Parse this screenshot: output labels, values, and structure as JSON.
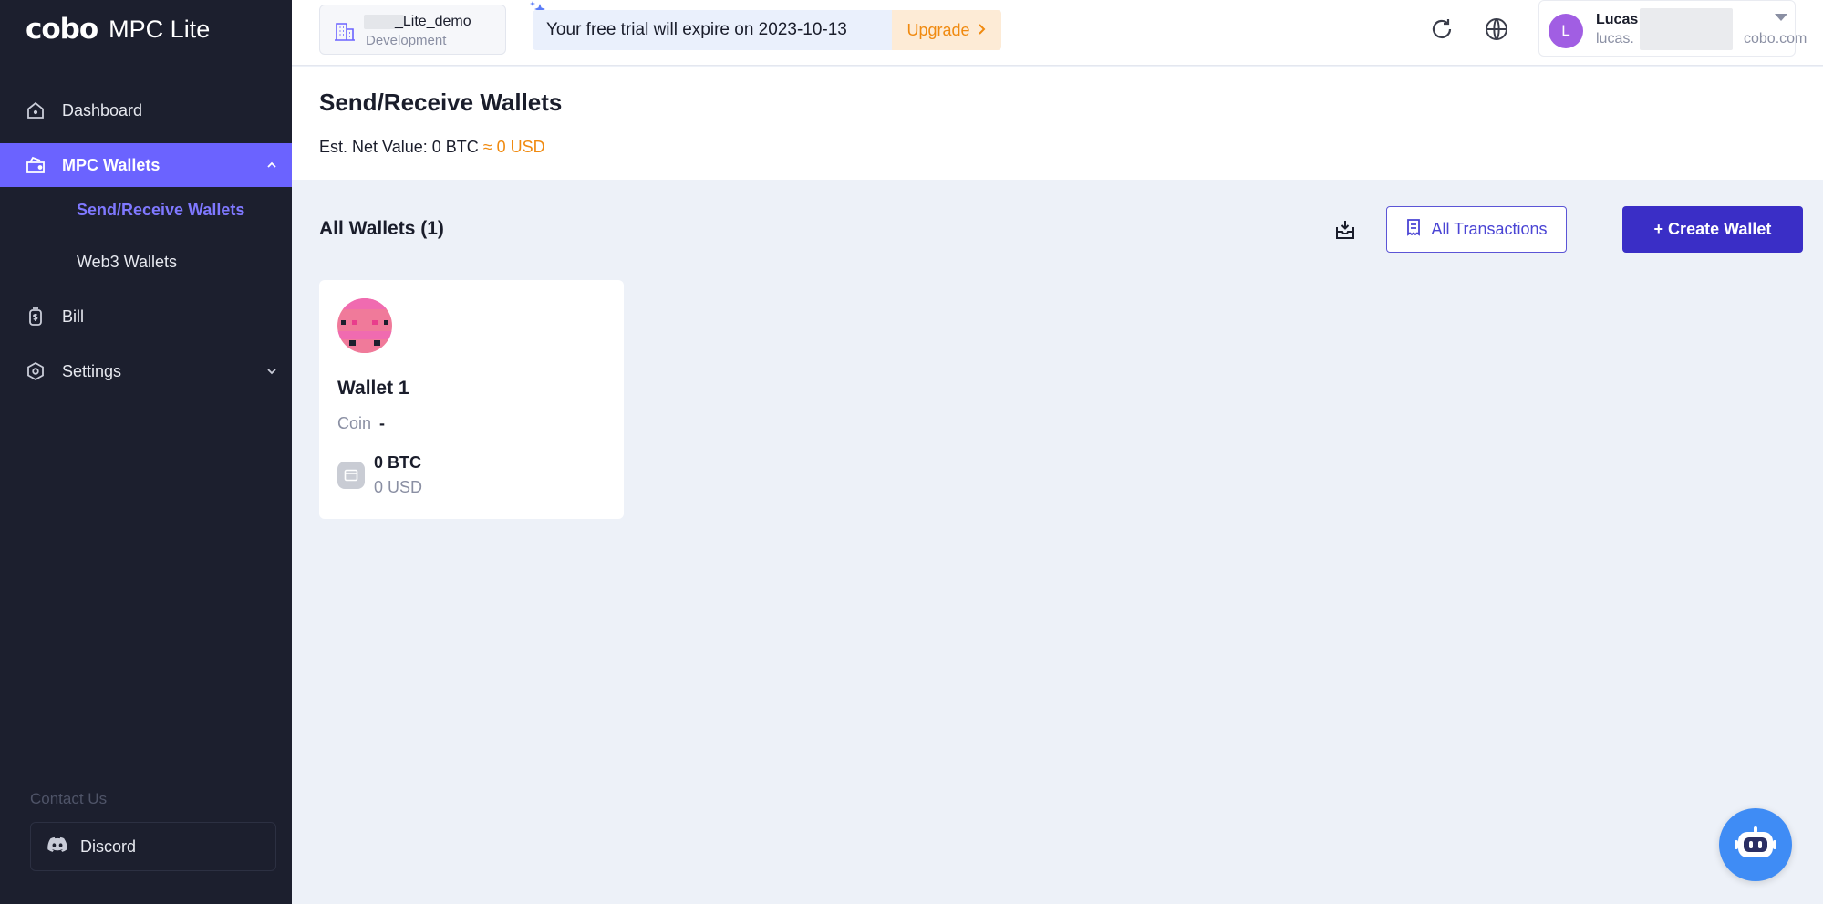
{
  "app": {
    "logo_mark": "cobo",
    "logo_text": "MPC Lite"
  },
  "sidebar": {
    "items": [
      {
        "label": "Dashboard",
        "icon": "home-icon"
      },
      {
        "label": "MPC Wallets",
        "icon": "wallet-icon",
        "expanded": true,
        "active": true
      },
      {
        "label": "Bill",
        "icon": "bill-icon"
      },
      {
        "label": "Settings",
        "icon": "settings-icon",
        "expanded": false
      }
    ],
    "sub_items": [
      {
        "label": "Send/Receive Wallets",
        "active": true
      },
      {
        "label": "Web3 Wallets",
        "active": false
      }
    ],
    "contact_label": "Contact Us",
    "discord_label": "Discord"
  },
  "topbar": {
    "org_name": "_Lite_demo",
    "org_env": "Development",
    "trial_text": "Your free trial will expire on 2023-10-13",
    "upgrade_label": "Upgrade",
    "user_initial": "L",
    "user_name": "Lucas",
    "user_email_prefix": "lucas.",
    "user_email_domain": "cobo.com"
  },
  "header": {
    "title": "Send/Receive Wallets",
    "net_value_label": "Est. Net Value: 0 BTC",
    "net_value_usd": "≈ 0 USD"
  },
  "content": {
    "section_title": "All Wallets (1)",
    "all_transactions_label": "All Transactions",
    "create_wallet_label": "+ Create Wallet"
  },
  "wallets": [
    {
      "name": "Wallet 1",
      "coin_label": "Coin",
      "coin_value": "-",
      "balance_btc": "0 BTC",
      "balance_usd": "0 USD"
    }
  ],
  "colors": {
    "accent": "#6b63ff",
    "primary_button": "#3a2ec6",
    "warning": "#f08a10",
    "sidebar_bg": "#1c1f2e"
  }
}
